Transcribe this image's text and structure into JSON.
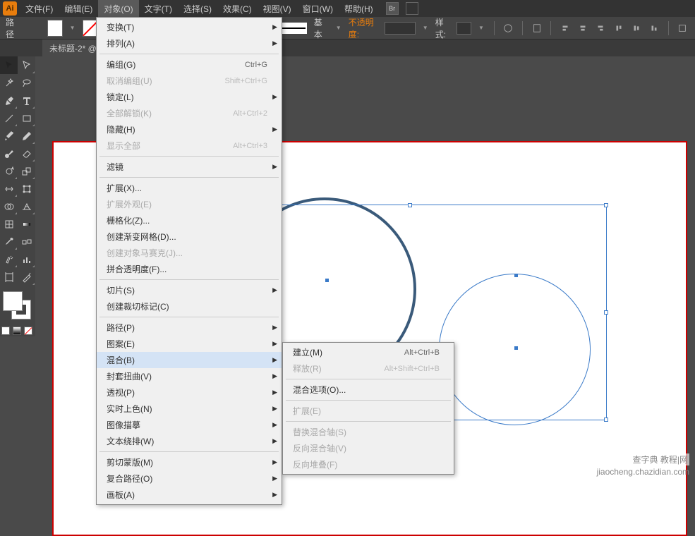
{
  "menubar": {
    "items": [
      "文件(F)",
      "编辑(E)",
      "对象(O)",
      "文字(T)",
      "选择(S)",
      "效果(C)",
      "视图(V)",
      "窗口(W)",
      "帮助(H)"
    ],
    "active_index": 2
  },
  "optionbar": {
    "path_label": "路径",
    "stroke_label": "基本",
    "opacity_label": "不透明度:",
    "style_label": "样式:"
  },
  "document": {
    "tab": "未标题-2* @"
  },
  "object_menu": {
    "items": [
      {
        "label": "变换(T)",
        "submenu": true
      },
      {
        "label": "排列(A)",
        "submenu": true
      },
      {
        "sep": true
      },
      {
        "label": "编组(G)",
        "shortcut": "Ctrl+G"
      },
      {
        "label": "取消编组(U)",
        "shortcut": "Shift+Ctrl+G",
        "disabled": true
      },
      {
        "label": "锁定(L)",
        "submenu": true
      },
      {
        "label": "全部解锁(K)",
        "shortcut": "Alt+Ctrl+2",
        "disabled": true
      },
      {
        "label": "隐藏(H)",
        "submenu": true
      },
      {
        "label": "显示全部",
        "shortcut": "Alt+Ctrl+3",
        "disabled": true
      },
      {
        "sep": true
      },
      {
        "label": "滤镜",
        "submenu": true
      },
      {
        "sep": true
      },
      {
        "label": "扩展(X)..."
      },
      {
        "label": "扩展外观(E)",
        "disabled": true
      },
      {
        "label": "栅格化(Z)..."
      },
      {
        "label": "创建渐变网格(D)..."
      },
      {
        "label": "创建对象马赛克(J)...",
        "disabled": true
      },
      {
        "label": "拼合透明度(F)..."
      },
      {
        "sep": true
      },
      {
        "label": "切片(S)",
        "submenu": true
      },
      {
        "label": "创建裁切标记(C)"
      },
      {
        "sep": true
      },
      {
        "label": "路径(P)",
        "submenu": true
      },
      {
        "label": "图案(E)",
        "submenu": true
      },
      {
        "label": "混合(B)",
        "submenu": true,
        "highlighted": true
      },
      {
        "label": "封套扭曲(V)",
        "submenu": true
      },
      {
        "label": "透视(P)",
        "submenu": true
      },
      {
        "label": "实时上色(N)",
        "submenu": true
      },
      {
        "label": "图像描摹",
        "submenu": true
      },
      {
        "label": "文本绕排(W)",
        "submenu": true
      },
      {
        "sep": true
      },
      {
        "label": "剪切蒙版(M)",
        "submenu": true
      },
      {
        "label": "复合路径(O)",
        "submenu": true
      },
      {
        "label": "画板(A)",
        "submenu": true
      }
    ]
  },
  "blend_submenu": {
    "items": [
      {
        "label": "建立(M)",
        "shortcut": "Alt+Ctrl+B"
      },
      {
        "label": "释放(R)",
        "shortcut": "Alt+Shift+Ctrl+B",
        "disabled": true
      },
      {
        "sep": true
      },
      {
        "label": "混合选项(O)..."
      },
      {
        "sep": true
      },
      {
        "label": "扩展(E)",
        "disabled": true
      },
      {
        "sep": true
      },
      {
        "label": "替换混合轴(S)",
        "disabled": true
      },
      {
        "label": "反向混合轴(V)",
        "disabled": true
      },
      {
        "label": "反向堆叠(F)",
        "disabled": true
      }
    ]
  },
  "watermark": {
    "cn": "查字典 教程|网",
    "url": "jiaocheng.chazidian.com"
  }
}
